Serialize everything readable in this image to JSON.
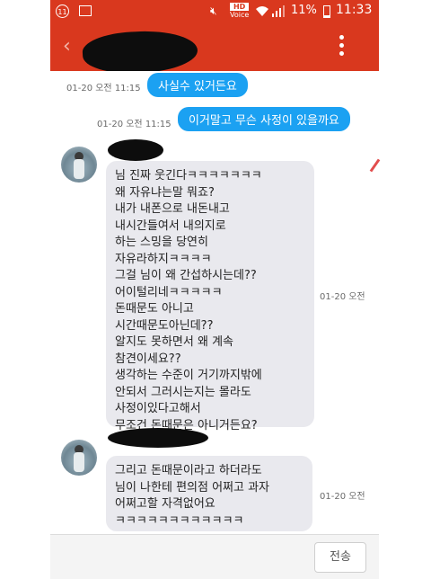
{
  "status_bar": {
    "notification_count": "11",
    "hd_label": "HD",
    "voice_label": "Voice",
    "battery_percent": "11%",
    "time": "11:33",
    "icons": [
      "notification-icon",
      "photo-icon",
      "mute-icon",
      "hd-voice-icon",
      "wifi-icon",
      "signal-icon",
      "battery-icon"
    ]
  },
  "app_bar": {
    "back_icon": "chevron-left-icon",
    "menu_icon": "more-vert-icon"
  },
  "messages": [
    {
      "type": "sent",
      "time": "01-20 오전 11:15",
      "text": "사실수 있거든요"
    },
    {
      "type": "sent",
      "time": "01-20 오전 11:15",
      "text": "이거말고 무슨 사정이 있을까요"
    },
    {
      "type": "received",
      "time": "01-20 오전",
      "lines": [
        "님 진짜 웃긴다ㅋㅋㅋㅋㅋㅋㅋ",
        "왜 자유냐는말 뭐죠?",
        "내가 내폰으로 내돈내고",
        "내시간들여서 내의지로",
        "하는 스밍을 당연히",
        "자유라하지ㅋㅋㅋㅋ",
        "그걸 님이 왜 간섭하시는데??",
        "어이털리네ㅋㅋㅋㅋㅋ",
        "돈때문도 아니고",
        "시간때문도아닌데??",
        "알지도 못하면서 왜 계속",
        "참견이세요??",
        "생각하는 수준이 거기까지밖에",
        "안되서 그러시는지는 몰라도",
        "사정이있다고해서",
        "무조건 돈때문은 아니거든요?"
      ]
    },
    {
      "type": "received",
      "time": "01-20 오전",
      "lines": [
        "그리고 돈때문이라고 하더라도",
        "님이 나한테 편의점 어쩌고 과자",
        "어쩌고할 자격없어요",
        "ㅋㅋㅋㅋㅋㅋㅋㅋㅋㅋㅋㅋ"
      ]
    }
  ],
  "input_bar": {
    "placeholder": "",
    "send_label": "전송"
  },
  "colors": {
    "app_bar": "#d9381e",
    "sent_bubble": "#1ba1f2",
    "received_bubble": "#e9e9ee"
  }
}
